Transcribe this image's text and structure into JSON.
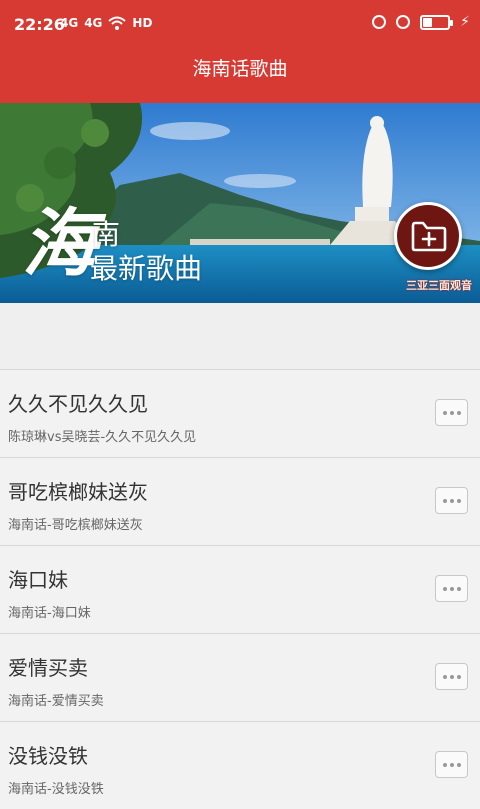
{
  "status": {
    "time": "22:26",
    "net_labels": [
      "4G",
      "4G",
      "HD"
    ],
    "battery_level": 0.35
  },
  "header": {
    "title": "海南话歌曲"
  },
  "banner": {
    "big_char": "海",
    "small_char": "南",
    "line": "最新歌曲",
    "watermark": "三亚三面观音"
  },
  "songs": [
    {
      "title": "久久不见久久见",
      "subtitle": "陈琼琳vs吴晓芸-久久不见久久见"
    },
    {
      "title": "哥吃槟榔妹送灰",
      "subtitle": "海南话-哥吃槟榔妹送灰"
    },
    {
      "title": "海口妹",
      "subtitle": "海南话-海口妹"
    },
    {
      "title": "爱情买卖",
      "subtitle": "海南话-爱情买卖"
    },
    {
      "title": "没钱没铁",
      "subtitle": "海南话-没钱没铁"
    }
  ],
  "colors": {
    "accent": "#d63a32",
    "fab": "#6e1712"
  },
  "icons": {
    "fab": "folder-plus-icon",
    "more": "more-dots-icon"
  }
}
